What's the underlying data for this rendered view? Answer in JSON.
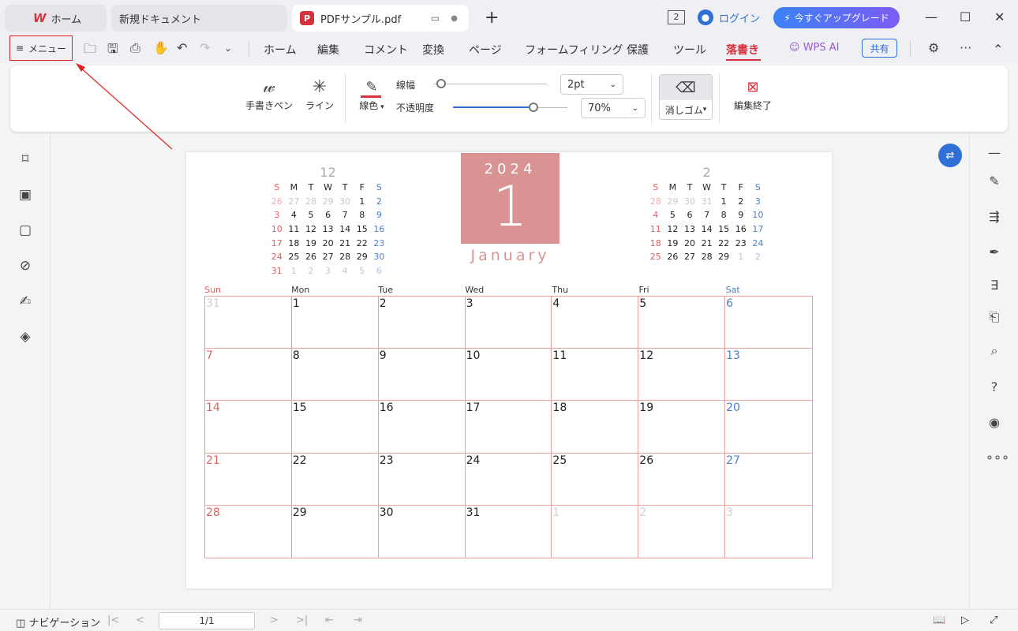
{
  "tabs": {
    "home": "ホーム",
    "new_doc": "新規ドキュメント",
    "pdf": "PDFサンプル.pdf"
  },
  "titlebar": {
    "window_count": "2",
    "login": "ログイン",
    "upgrade": "今すぐアップグレード"
  },
  "menubar": {
    "menu": "メニュー",
    "tabs": [
      "ホーム",
      "編集",
      "コメント",
      "変換",
      "ページ",
      "フォームフィリング",
      "保護",
      "ツール",
      "落書き"
    ],
    "active_tab": "落書き",
    "wps_ai": "WPS AI",
    "share": "共有"
  },
  "ribbon": {
    "pen": "手書きペン",
    "line": "ライン",
    "line_color": "線色",
    "line_width_label": "線幅",
    "line_width_value": "2pt",
    "line_width_level": 0.0,
    "opacity_label": "不透明度",
    "opacity_value": "70%",
    "opacity_level": 0.7,
    "eraser": "消しゴム",
    "finish": "編集終了",
    "accent_color": "#d6323e"
  },
  "document": {
    "year": "2024",
    "month_number": "1",
    "month_name": "January",
    "prev_month": {
      "number": "12",
      "headers": [
        "S",
        "M",
        "T",
        "W",
        "T",
        "F",
        "S"
      ],
      "weeks": [
        [
          "26",
          "27",
          "28",
          "29",
          "30",
          "1",
          "2"
        ],
        [
          "3",
          "4",
          "5",
          "6",
          "7",
          "8",
          "9"
        ],
        [
          "10",
          "11",
          "12",
          "13",
          "14",
          "15",
          "16"
        ],
        [
          "17",
          "18",
          "19",
          "20",
          "21",
          "22",
          "23"
        ],
        [
          "24",
          "25",
          "26",
          "27",
          "28",
          "29",
          "30"
        ],
        [
          "31",
          "1",
          "2",
          "3",
          "4",
          "5",
          "6"
        ]
      ]
    },
    "next_month": {
      "number": "2",
      "headers": [
        "S",
        "M",
        "T",
        "W",
        "T",
        "F",
        "S"
      ],
      "weeks": [
        [
          "28",
          "29",
          "30",
          "31",
          "1",
          "2",
          "3"
        ],
        [
          "4",
          "5",
          "6",
          "7",
          "8",
          "9",
          "10"
        ],
        [
          "11",
          "12",
          "13",
          "14",
          "15",
          "16",
          "17"
        ],
        [
          "18",
          "19",
          "20",
          "21",
          "22",
          "23",
          "24"
        ],
        [
          "25",
          "26",
          "27",
          "28",
          "29",
          "1",
          "2"
        ]
      ]
    },
    "weekday_names": [
      "Sun",
      "Mon",
      "Tue",
      "Wed",
      "Thu",
      "Fri",
      "Sat"
    ],
    "main_weeks": [
      [
        "31",
        "1",
        "2",
        "3",
        "4",
        "5",
        "6"
      ],
      [
        "7",
        "8",
        "9",
        "10",
        "11",
        "12",
        "13"
      ],
      [
        "14",
        "15",
        "16",
        "17",
        "18",
        "19",
        "20"
      ],
      [
        "21",
        "22",
        "23",
        "24",
        "25",
        "26",
        "27"
      ],
      [
        "28",
        "29",
        "30",
        "31",
        "1",
        "2",
        "3"
      ]
    ],
    "sunday_color": "#e06060",
    "saturday_color": "#4a80c8",
    "highlight_color": "#d99393"
  },
  "statusbar": {
    "navigation": "ナビゲーション",
    "page": "1/1"
  },
  "icons": {
    "left": [
      "bookmark-icon",
      "thumbnail-icon",
      "comment-icon",
      "attachment-icon",
      "signature-icon",
      "layers-icon"
    ],
    "right": [
      "minimize-panel-icon",
      "edit-icon",
      "export-icon",
      "sign-icon",
      "compare-icon",
      "ocr-icon",
      "search-icon",
      "help-icon",
      "eye-icon",
      "more-icon"
    ]
  }
}
